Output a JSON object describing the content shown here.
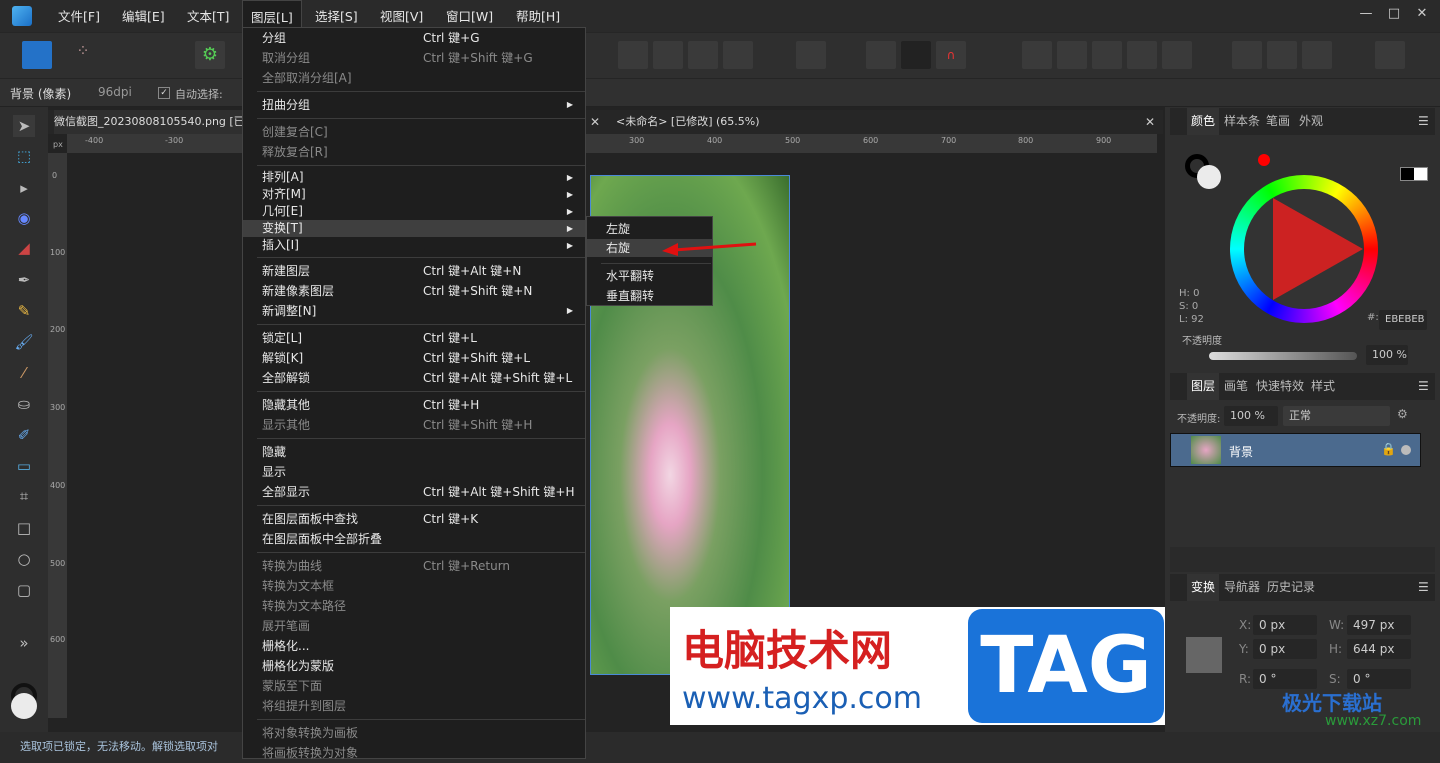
{
  "menubar": {
    "items": [
      "文件[F]",
      "编辑[E]",
      "文本[T]",
      "图层[L]",
      "选择[S]",
      "视图[V]",
      "窗口[W]",
      "帮助[H]"
    ]
  },
  "context": {
    "layer": "背景 (像素)",
    "dpi": "96dpi",
    "auto_select": "自动选择:"
  },
  "tabs": [
    "微信截图_20230808105540.png [已",
    "<未命名> [已修改] (65.5%)"
  ],
  "ruler": {
    "unit": "px",
    "h": [
      "-400",
      "-300",
      "300",
      "400",
      "500",
      "600",
      "700",
      "800",
      "900"
    ],
    "v": [
      "0",
      "100",
      "200",
      "300",
      "400",
      "500",
      "600"
    ]
  },
  "menu": [
    {
      "label": "分组",
      "sc": "Ctrl 键+G"
    },
    {
      "label": "取消分组",
      "sc": "Ctrl 键+Shift 键+G",
      "dis": true
    },
    {
      "label": "全部取消分组[A]",
      "dis": true
    },
    {
      "sep": true
    },
    {
      "label": "扭曲分组",
      "sub": true
    },
    {
      "sep": true
    },
    {
      "label": "创建复合[C]",
      "dis": true
    },
    {
      "label": "释放复合[R]",
      "dis": true
    },
    {
      "sep": true
    },
    {
      "label": "排列[A]",
      "sub": true,
      "c": true
    },
    {
      "label": "对齐[M]",
      "sub": true,
      "c": true
    },
    {
      "label": "几何[E]",
      "sub": true,
      "c": true
    },
    {
      "label": "变换[T]",
      "sub": true,
      "c": true,
      "hl": true
    },
    {
      "label": "插入[I]",
      "sub": true,
      "c": true
    },
    {
      "sep": true
    },
    {
      "label": "新建图层",
      "sc": "Ctrl 键+Alt 键+N"
    },
    {
      "label": "新建像素图层",
      "sc": "Ctrl 键+Shift 键+N"
    },
    {
      "label": "新调整[N]",
      "sub": true
    },
    {
      "sep": true
    },
    {
      "label": "锁定[L]",
      "sc": "Ctrl 键+L"
    },
    {
      "label": "解锁[K]",
      "sc": "Ctrl 键+Shift 键+L"
    },
    {
      "label": "全部解锁",
      "sc": "Ctrl 键+Alt 键+Shift 键+L"
    },
    {
      "sep": true
    },
    {
      "label": "隐藏其他",
      "sc": "Ctrl 键+H"
    },
    {
      "label": "显示其他",
      "sc": "Ctrl 键+Shift 键+H",
      "dis": true
    },
    {
      "sep": true
    },
    {
      "label": "隐藏"
    },
    {
      "label": "显示"
    },
    {
      "label": "全部显示",
      "sc": "Ctrl 键+Alt 键+Shift 键+H"
    },
    {
      "sep": true
    },
    {
      "label": "在图层面板中查找",
      "sc": "Ctrl 键+K"
    },
    {
      "label": "在图层面板中全部折叠"
    },
    {
      "sep": true
    },
    {
      "label": "转换为曲线",
      "sc": "Ctrl 键+Return",
      "dis": true
    },
    {
      "label": "转换为文本框",
      "dis": true
    },
    {
      "label": "转换为文本路径",
      "dis": true
    },
    {
      "label": "展开笔画",
      "dis": true
    },
    {
      "label": "栅格化..."
    },
    {
      "label": "栅格化为蒙版"
    },
    {
      "label": "蒙版至下面",
      "dis": true
    },
    {
      "label": "将组提升到图层",
      "dis": true
    },
    {
      "sep": true
    },
    {
      "label": "将对象转换为画板",
      "dis": true
    },
    {
      "label": "将画板转换为对象",
      "dis": true
    }
  ],
  "submenu": [
    "左旋",
    "右旋",
    "水平翻转",
    "垂直翻转"
  ],
  "color_panel": {
    "tabs": [
      "颜色",
      "样本条",
      "笔画",
      "外观"
    ],
    "h": "H: 0",
    "s": "S: 0",
    "l": "L: 92",
    "hex_label": "#:",
    "hex": "EBEBEB",
    "opacity_label": "不透明度",
    "opacity": "100 %"
  },
  "layers_panel": {
    "tabs": [
      "图层",
      "画笔",
      "快速特效",
      "样式"
    ],
    "opacity_label": "不透明度:",
    "opacity": "100 %",
    "blend": "正常",
    "layer_name": "背景"
  },
  "transform_panel": {
    "tabs": [
      "变换",
      "导航器",
      "历史记录"
    ],
    "x_label": "X:",
    "x": "0 px",
    "y_label": "Y:",
    "y": "0 px",
    "w_label": "W:",
    "w": "497 px",
    "h_label": "H:",
    "h": "644 px",
    "r_label": "R:",
    "r": "0 °",
    "s_label": "S:",
    "s": "0 °"
  },
  "status": "选取项已锁定，无法移动。解锁选取项对",
  "watermark": {
    "title": "电脑技术网",
    "url": "www.tagxp.com",
    "badge": "TAG",
    "site2": "极光下载站",
    "url2": "www.xz7.com"
  }
}
